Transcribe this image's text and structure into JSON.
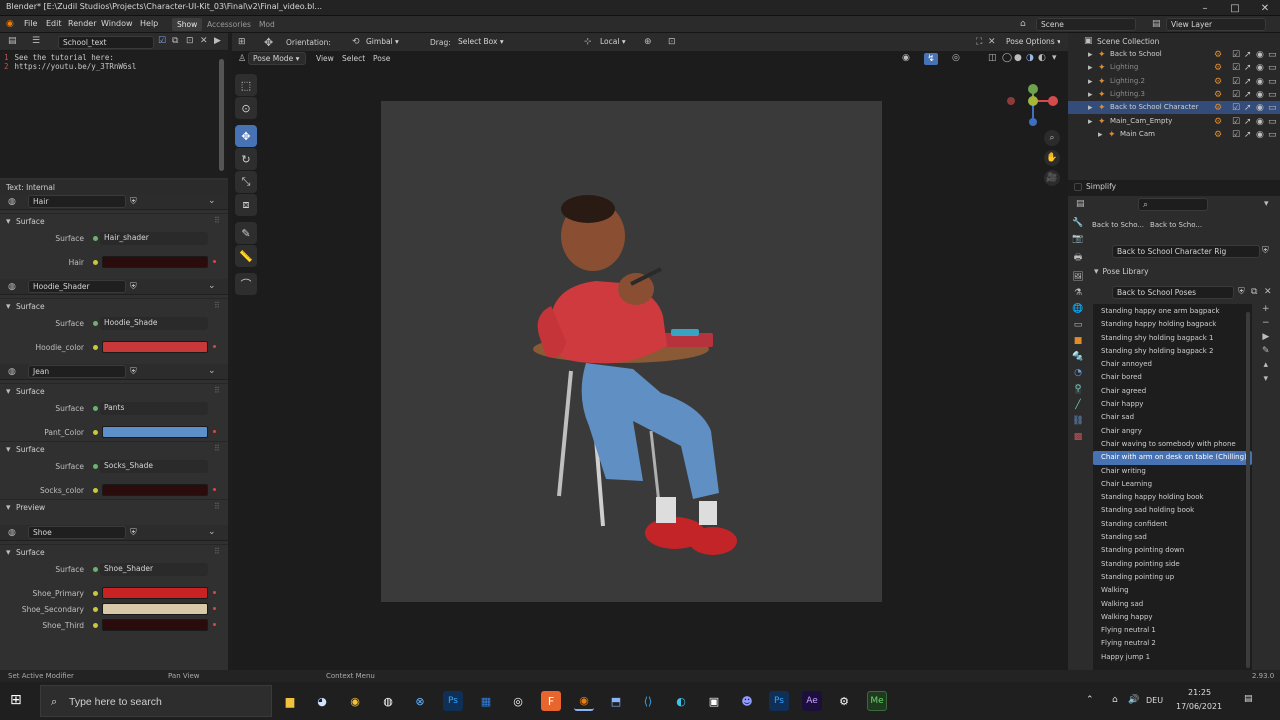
{
  "window": {
    "title": "Blender* [E:\\Zudil Studios\\Projects\\Character-UI-Kit_03\\Final\\v2\\Final_video.bl..."
  },
  "menubar": {
    "menus": [
      "File",
      "Edit",
      "Render",
      "Window",
      "Help"
    ],
    "workspaces": [
      "Show",
      "Accessories",
      "Mod"
    ],
    "scene_label": "Scene",
    "view_layer_label": "View Layer"
  },
  "text_editor": {
    "file_name": "School_text",
    "lines": [
      {
        "no": "1",
        "text": "See the tutorial here:"
      },
      {
        "no": "2",
        "text": "   https://youtu.be/y_3TRnW6sl"
      }
    ],
    "footer": "Text: Internal"
  },
  "shader_panels": [
    {
      "name": "Hair",
      "props": [
        {
          "type": "section",
          "label": "Surface"
        },
        {
          "type": "shader",
          "label": "Surface",
          "value": "Hair_shader"
        },
        {
          "type": "color",
          "label": "Hair",
          "color": "#2a0c0c"
        }
      ]
    },
    {
      "name": "Hoodie_Shader",
      "props": [
        {
          "type": "section",
          "label": "Surface"
        },
        {
          "type": "shader",
          "label": "Surface",
          "value": "Hoodie_Shade"
        },
        {
          "type": "color",
          "label": "Hoodie_color",
          "color": "#c83838"
        }
      ]
    },
    {
      "name": "Jean",
      "props": [
        {
          "type": "section",
          "label": "Surface"
        },
        {
          "type": "shader",
          "label": "Surface",
          "value": "Pants"
        },
        {
          "type": "color",
          "label": "Pant_Color",
          "color": "#5d8fca"
        },
        {
          "type": "section",
          "label": "Surface"
        },
        {
          "type": "shader",
          "label": "Surface",
          "value": "Socks_Shade"
        },
        {
          "type": "color",
          "label": "Socks_color",
          "color": "#2a0c0c"
        },
        {
          "type": "section",
          "label": "Preview"
        }
      ]
    },
    {
      "name": "Shoe",
      "props": [
        {
          "type": "section",
          "label": "Surface"
        },
        {
          "type": "shader",
          "label": "Surface",
          "value": "Shoe_Shader"
        },
        {
          "type": "color",
          "label": "Shoe_Primary",
          "color": "#c82222"
        },
        {
          "type": "color",
          "label": "Shoe_Secondary",
          "color": "#d8c9a8"
        },
        {
          "type": "color",
          "label": "Shoe_Third",
          "color": "#2a0c0c"
        }
      ]
    }
  ],
  "viewport": {
    "header": {
      "orientation": "Orientation:",
      "orientation_value": "Gimbal",
      "drag": "Drag:",
      "drag_value": "Select Box",
      "local": "Local",
      "pose_options": "Pose Options"
    },
    "mode": "Pose Mode",
    "menus": [
      "View",
      "Select",
      "Pose"
    ]
  },
  "outliner": {
    "title": "Scene Collection",
    "rows": [
      {
        "label": "Back to School",
        "indent": 1
      },
      {
        "label": "Lighting",
        "indent": 1
      },
      {
        "label": "Lighting.2",
        "indent": 1
      },
      {
        "label": "Lighting.3",
        "indent": 1
      },
      {
        "label": "Back to School Character",
        "indent": 1,
        "selected": true
      },
      {
        "label": "Main_Cam_Empty",
        "indent": 1
      },
      {
        "label": "Main Cam",
        "indent": 2
      }
    ],
    "simplify": "Simplify"
  },
  "properties": {
    "tabs": [
      "Back to Scho...",
      "Back to Scho..."
    ],
    "object": "Back to School Character Rig",
    "pose_library_label": "Pose Library",
    "pose_library_name": "Back to School Poses",
    "poses": [
      "Standing happy one arm bagpack",
      "Standing happy holding bagpack",
      "Standing shy holding bagpack 1",
      "Standing shy holding bagpack 2",
      "Chair annoyed",
      "Chair bored",
      "Chair agreed",
      "Chair happy",
      "Chair sad",
      "Chair angry",
      "Chair waving to somebody with phone",
      "Chair with arm on desk on table (Chilling)",
      "Chair writing",
      "Chair Learning",
      "Standing happy holding book",
      "Standing sad holding book",
      "Standing confident",
      "Standing sad",
      "Standing pointing down",
      "Standing pointing side",
      "Standing pointing up",
      "Walking",
      "Walking sad",
      "Walking happy",
      "Flying neutral 1",
      "Flying neutral 2",
      "Happy jump 1"
    ],
    "selected_index": 11
  },
  "statusbar": {
    "items": [
      "Set Active Modifier",
      "Pan View",
      "Context Menu"
    ],
    "version": "2.93.0"
  },
  "taskbar": {
    "search_placeholder": "Type here to search",
    "time": "21:25",
    "date": "17/06/2021",
    "lang": "DEU"
  }
}
